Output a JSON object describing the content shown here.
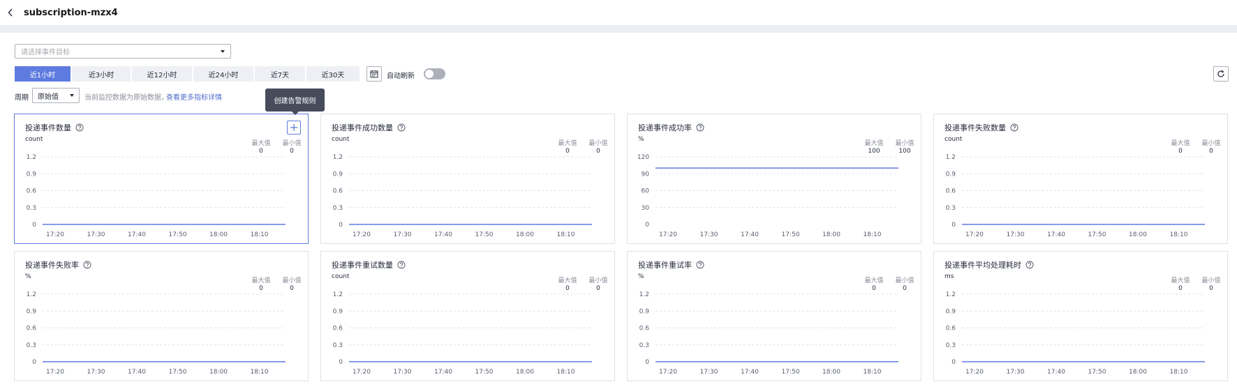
{
  "header": {
    "title": "subscription-mzx4"
  },
  "filter": {
    "placeholder": "请选择事件目标"
  },
  "time_ranges": [
    "近1小时",
    "近3小时",
    "近12小时",
    "近24小时",
    "近7天",
    "近30天"
  ],
  "active_range": "近1小时",
  "auto_refresh": {
    "label": "自动刷新",
    "enabled": false
  },
  "period": {
    "label": "周期",
    "value": "原始值",
    "hint": "当前监控数据为原始数据，",
    "link": "查看更多指标详情"
  },
  "tooltip": {
    "text": "创建告警规则"
  },
  "stat_labels": {
    "max": "最大值",
    "min": "最小值"
  },
  "colors": {
    "accent": "#5e7ce0",
    "line": "#5e7ce0"
  },
  "icons": [
    "chevron-left-icon",
    "chevron-down-icon",
    "calendar-icon",
    "refresh-icon",
    "help-icon",
    "plus-icon"
  ],
  "cards": [
    {
      "title": "投递事件数量",
      "unit": "count",
      "max": "0",
      "min": "0",
      "active": true
    },
    {
      "title": "投递事件成功数量",
      "unit": "count",
      "max": "0",
      "min": "0"
    },
    {
      "title": "投递事件成功率",
      "unit": "%",
      "max": "100",
      "min": "100"
    },
    {
      "title": "投递事件失败数量",
      "unit": "count",
      "max": "0",
      "min": "0"
    },
    {
      "title": "投递事件失败率",
      "unit": "%",
      "max": "0",
      "min": "0"
    },
    {
      "title": "投递事件重试数量",
      "unit": "count",
      "max": "0",
      "min": "0"
    },
    {
      "title": "投递事件重试率",
      "unit": "%",
      "max": "0",
      "min": "0"
    },
    {
      "title": "投递事件平均处理耗时",
      "unit": "ms",
      "max": "0",
      "min": "0"
    }
  ],
  "chart_data": [
    {
      "type": "line",
      "x": [
        "17:20",
        "17:30",
        "17:40",
        "17:50",
        "18:00",
        "18:10"
      ],
      "yticks": [
        0,
        0.3,
        0.6,
        0.9,
        1.2
      ],
      "ylim": [
        0,
        1.2
      ],
      "series": [
        {
          "values": [
            0,
            0,
            0,
            0,
            0,
            0
          ]
        }
      ]
    },
    {
      "type": "line",
      "x": [
        "17:20",
        "17:30",
        "17:40",
        "17:50",
        "18:00",
        "18:10"
      ],
      "yticks": [
        0,
        0.3,
        0.6,
        0.9,
        1.2
      ],
      "ylim": [
        0,
        1.2
      ],
      "series": [
        {
          "values": [
            0,
            0,
            0,
            0,
            0,
            0
          ]
        }
      ]
    },
    {
      "type": "line",
      "x": [
        "17:20",
        "17:30",
        "17:40",
        "17:50",
        "18:00",
        "18:10"
      ],
      "yticks": [
        0,
        30,
        60,
        90,
        120
      ],
      "ylim": [
        0,
        120
      ],
      "series": [
        {
          "values": [
            100,
            100,
            100,
            100,
            100,
            100
          ]
        }
      ]
    },
    {
      "type": "line",
      "x": [
        "17:20",
        "17:30",
        "17:40",
        "17:50",
        "18:00",
        "18:10"
      ],
      "yticks": [
        0,
        0.3,
        0.6,
        0.9,
        1.2
      ],
      "ylim": [
        0,
        1.2
      ],
      "series": [
        {
          "values": [
            0,
            0,
            0,
            0,
            0,
            0
          ]
        }
      ]
    },
    {
      "type": "line",
      "x": [
        "17:20",
        "17:30",
        "17:40",
        "17:50",
        "18:00",
        "18:10"
      ],
      "yticks": [
        0,
        0.3,
        0.6,
        0.9,
        1.2
      ],
      "ylim": [
        0,
        1.2
      ],
      "series": [
        {
          "values": [
            0,
            0,
            0,
            0,
            0,
            0
          ]
        }
      ]
    },
    {
      "type": "line",
      "x": [
        "17:20",
        "17:30",
        "17:40",
        "17:50",
        "18:00",
        "18:10"
      ],
      "yticks": [
        0,
        0.3,
        0.6,
        0.9,
        1.2
      ],
      "ylim": [
        0,
        1.2
      ],
      "series": [
        {
          "values": [
            0,
            0,
            0,
            0,
            0,
            0
          ]
        }
      ]
    },
    {
      "type": "line",
      "x": [
        "17:20",
        "17:30",
        "17:40",
        "17:50",
        "18:00",
        "18:10"
      ],
      "yticks": [
        0,
        0.3,
        0.6,
        0.9,
        1.2
      ],
      "ylim": [
        0,
        1.2
      ],
      "series": [
        {
          "values": [
            0,
            0,
            0,
            0,
            0,
            0
          ]
        }
      ]
    },
    {
      "type": "line",
      "x": [
        "17:20",
        "17:30",
        "17:40",
        "17:50",
        "18:00",
        "18:10"
      ],
      "yticks": [
        0,
        0.3,
        0.6,
        0.9,
        1.2
      ],
      "ylim": [
        0,
        1.2
      ],
      "series": [
        {
          "values": [
            0,
            0,
            0,
            0,
            0,
            0
          ]
        }
      ]
    }
  ]
}
